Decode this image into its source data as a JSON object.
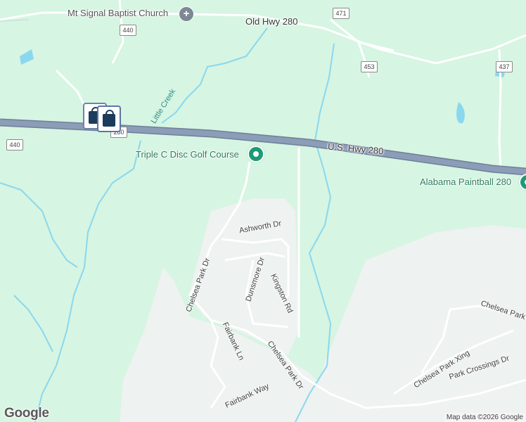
{
  "map": {
    "colors": {
      "land": "#d6f5e2",
      "water": "#8ad8ee",
      "highway": "#8c9db8",
      "road": "#ffffff",
      "developed": "#eef2f0"
    },
    "roads": {
      "old_hwy": "Old Hwy 280",
      "us_hwy": "U.S. Hwy 280",
      "ashworth": "Ashworth Dr",
      "chelsea_park_dr": "Chelsea Park Dr",
      "dunsmore": "Dunsmore Dr",
      "kingston": "Kingston Rd",
      "fairbank_ln": "Fairbank Ln",
      "fairbank_way": "Fairbank Way",
      "chelsea_park_dr_lower": "Chelsea Park Dr",
      "chelsea_park_xing": "Chelsea Park Xing",
      "park_crossings": "Park Crossings Dr",
      "chelsea_park_right": "Chelsea Park R"
    },
    "shields": {
      "s440_top": "440",
      "s471": "471",
      "s453": "453",
      "s437": "437",
      "s440_left": "440",
      "s280": "280"
    },
    "water": {
      "little_creek": "Little Creek"
    },
    "pois": {
      "church": "Mt Signal Baptist Church",
      "disc_golf": "Triple C Disc Golf Course",
      "paintball": "Alabama Paintball 280"
    },
    "icons": {
      "church": "church-cross-icon",
      "disc_golf": "park-pin-icon",
      "paintball": "park-pin-icon",
      "shopping": "shopping-bag-icon"
    },
    "logo": "Google",
    "attribution": "Map data ©2026 Google"
  }
}
